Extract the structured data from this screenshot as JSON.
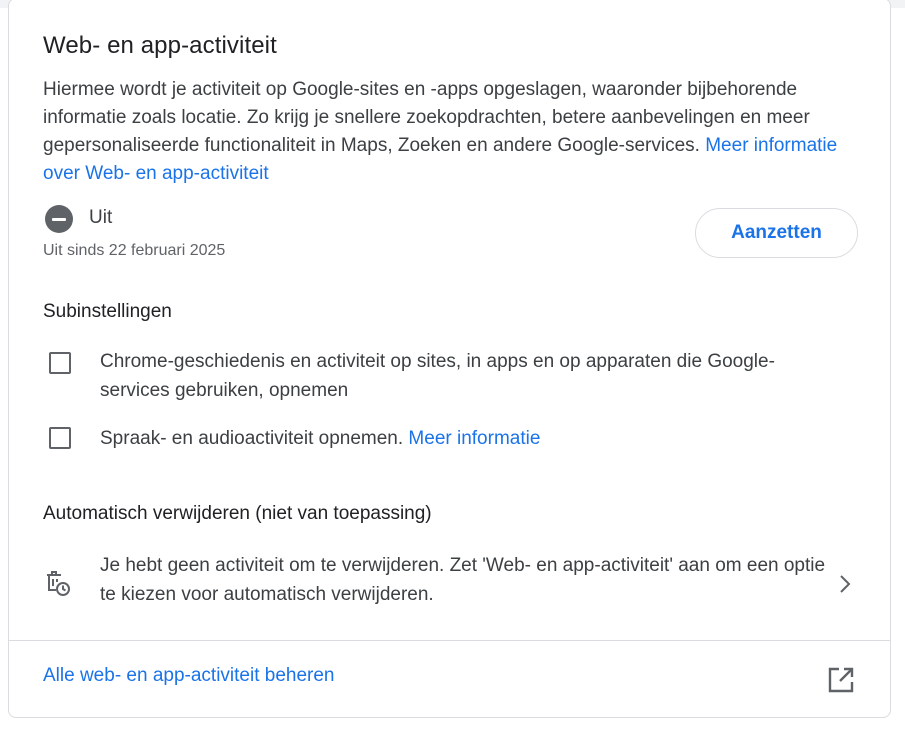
{
  "card": {
    "title": "Web- en app-activiteit",
    "description": "Hiermee wordt je activiteit op Google-sites en -apps opgeslagen, waaronder bijbehorende informatie zoals locatie. Zo krijg je snellere zoekopdrachten, betere aanbevelingen en meer gepersonaliseerde functionaliteit in Maps, Zoeken en andere Google-services.",
    "learn_more_link": "Meer informatie over Web- en app-activiteit"
  },
  "status": {
    "icon": "minus-circle-icon",
    "label": "Uit",
    "since": "Uit sinds 22 februari 2025",
    "button_label": "Aanzetten"
  },
  "subsettings": {
    "heading": "Subinstellingen",
    "items": [
      {
        "label": "Chrome-geschiedenis en activiteit op sites, in apps en op apparaten die Google-services gebruiken, opnemen",
        "link": "",
        "checked": false
      },
      {
        "label": "Spraak- en audioactiviteit opnemen.",
        "link": "Meer informatie",
        "checked": false
      }
    ]
  },
  "autodelete": {
    "heading": "Automatisch verwijderen (niet van toepassing)",
    "icon": "auto-delete-icon",
    "text": "Je hebt geen activiteit om te verwijderen. Zet 'Web- en app-activiteit' aan om een optie te kiezen voor automatisch verwijderen."
  },
  "footer": {
    "manage_link": "Alle web- en app-activiteit beheren",
    "icon": "open-in-new-icon"
  },
  "colors": {
    "accent": "#1a73e8",
    "text": "#3c4043",
    "icon_gray": "#5f6368",
    "border": "#dadce0"
  }
}
